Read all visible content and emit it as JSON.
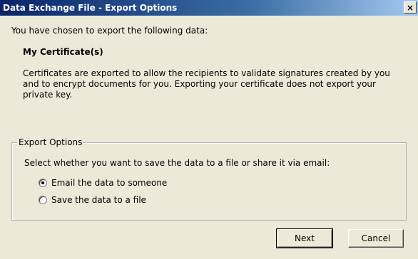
{
  "window": {
    "title": "Data Exchange File - Export Options",
    "close_glyph": "×"
  },
  "content": {
    "intro": "You have chosen to export the following data:",
    "subject": "My Certificate(s)",
    "description": "Certificates are exported to allow the recipients to validate signatures created by you and to encrypt documents for you. Exporting your certificate does not export your private key."
  },
  "export_options": {
    "group_label": "Export Options",
    "instruction": "Select whether you want to save the data to a file or share it via email:",
    "options": [
      {
        "label": "Email the data to someone",
        "selected": true
      },
      {
        "label": "Save the data to a file",
        "selected": false
      }
    ]
  },
  "buttons": {
    "next": "Next",
    "cancel": "Cancel"
  }
}
